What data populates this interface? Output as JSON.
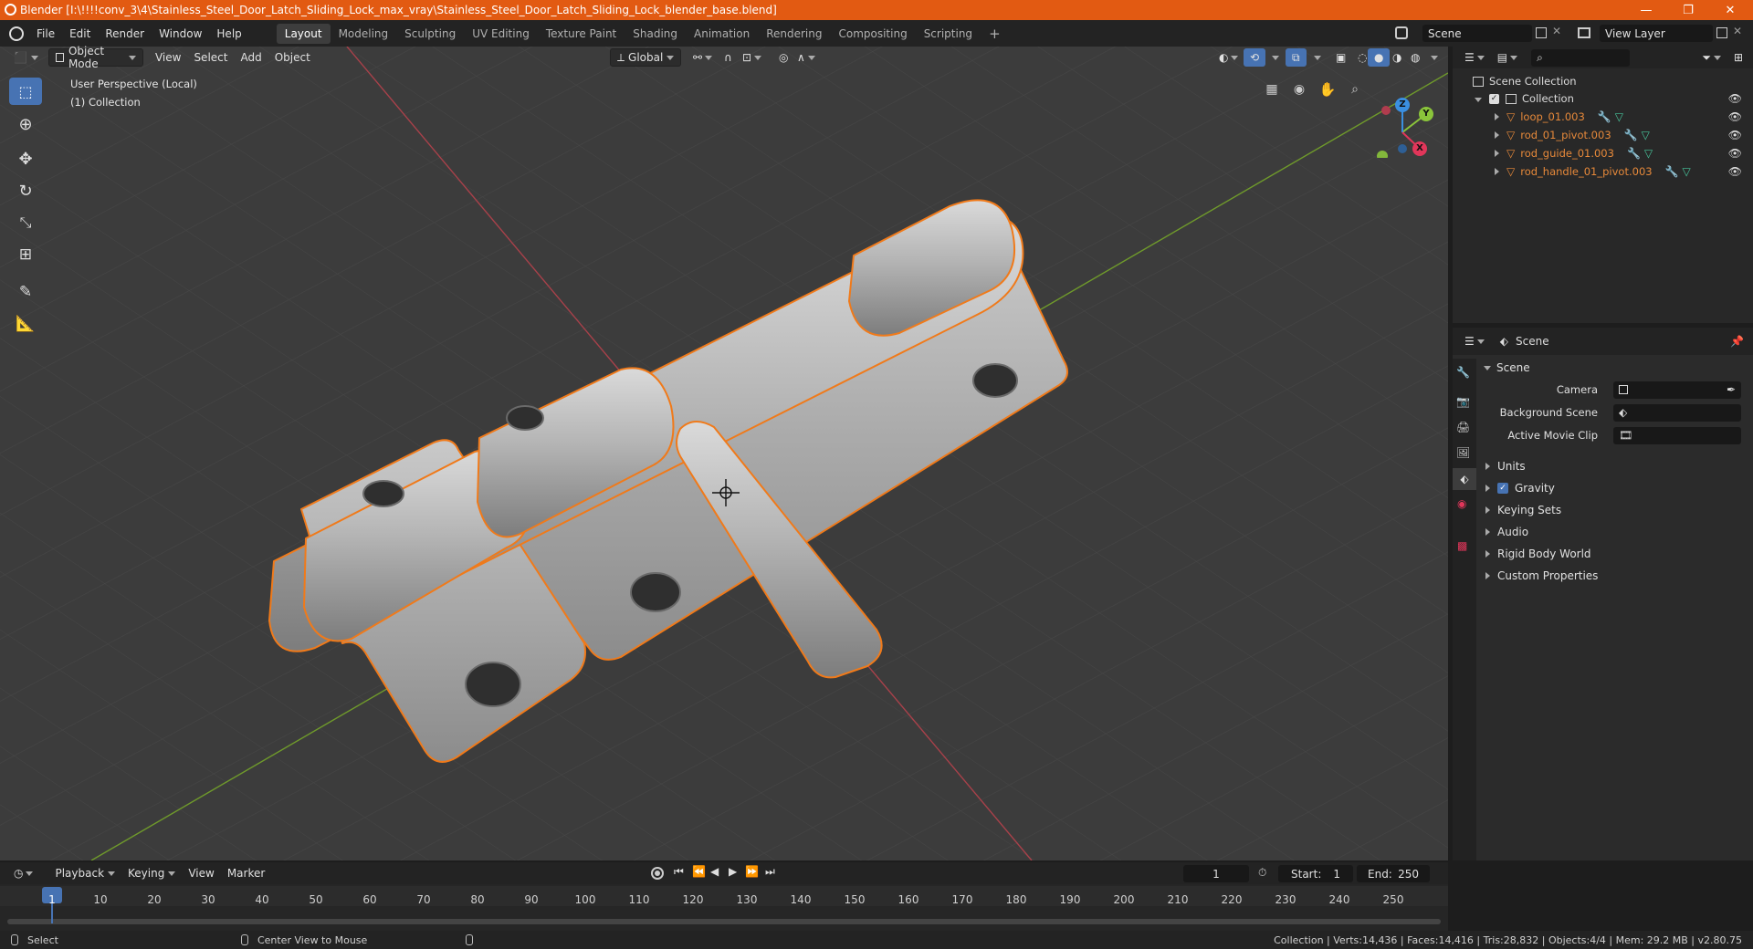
{
  "titlebar": {
    "title": "Blender [I:\\!!!!conv_3\\4\\Stainless_Steel_Door_Latch_Sliding_Lock_max_vray\\Stainless_Steel_Door_Latch_Sliding_Lock_blender_base.blend]",
    "minimize": "—",
    "maximize": "❐",
    "close": "✕"
  },
  "menus": [
    "File",
    "Edit",
    "Render",
    "Window",
    "Help"
  ],
  "workspaces": [
    "Layout",
    "Modeling",
    "Sculpting",
    "UV Editing",
    "Texture Paint",
    "Shading",
    "Animation",
    "Rendering",
    "Compositing",
    "Scripting"
  ],
  "add_workspace": "+",
  "scene_selector": {
    "value": "Scene"
  },
  "view_layer_selector": {
    "value": "View Layer"
  },
  "viewport_header": {
    "mode": "Object Mode",
    "menus": [
      "View",
      "Select",
      "Add",
      "Object"
    ],
    "transform_orientation": "Global"
  },
  "viewport": {
    "perspective_label": "User Perspective (Local)",
    "collection_label": "(1) Collection",
    "gizmo": {
      "x": "X",
      "y": "Y",
      "z": "Z"
    }
  },
  "outliner": {
    "search_icon": "⌕",
    "root": "Scene Collection",
    "collection": "Collection",
    "objects": [
      {
        "name": "loop_01.003"
      },
      {
        "name": "rod_01_pivot.003"
      },
      {
        "name": "rod_guide_01.003"
      },
      {
        "name": "rod_handle_01_pivot.003"
      }
    ]
  },
  "properties": {
    "header_title": "Scene",
    "panel_title": "Scene",
    "fields": [
      {
        "label": "Camera"
      },
      {
        "label": "Background Scene"
      },
      {
        "label": "Active Movie Clip"
      }
    ],
    "sections": [
      {
        "label": "Units",
        "checkbox": false
      },
      {
        "label": "Gravity",
        "checkbox": true
      },
      {
        "label": "Keying Sets",
        "checkbox": false
      },
      {
        "label": "Audio",
        "checkbox": false
      },
      {
        "label": "Rigid Body World",
        "checkbox": false
      },
      {
        "label": "Custom Properties",
        "checkbox": false
      }
    ]
  },
  "timeline": {
    "menus": [
      "Playback",
      "Keying",
      "View",
      "Marker"
    ],
    "current_frame": "1",
    "start_label": "Start:",
    "start_value": "1",
    "end_label": "End:",
    "end_value": "250",
    "ruler": [
      "1",
      "10",
      "20",
      "30",
      "40",
      "50",
      "60",
      "70",
      "80",
      "90",
      "100",
      "110",
      "120",
      "130",
      "140",
      "150",
      "160",
      "170",
      "180",
      "190",
      "200",
      "210",
      "220",
      "230",
      "240",
      "250"
    ]
  },
  "statusbar": {
    "select": "Select",
    "center_view": "Center View to Mouse",
    "stats": "Collection | Verts:14,436 | Faces:14,416 | Tris:28,832 | Objects:4/4 | Mem: 29.2 MB | v2.80.75"
  },
  "colors": {
    "accent_orange": "#e25a12",
    "selection_outline": "#f07a1a",
    "active_tool": "#4773b3",
    "axis_x": "#e1365a",
    "axis_y": "#8ac43b",
    "axis_z": "#3a8fe0"
  }
}
